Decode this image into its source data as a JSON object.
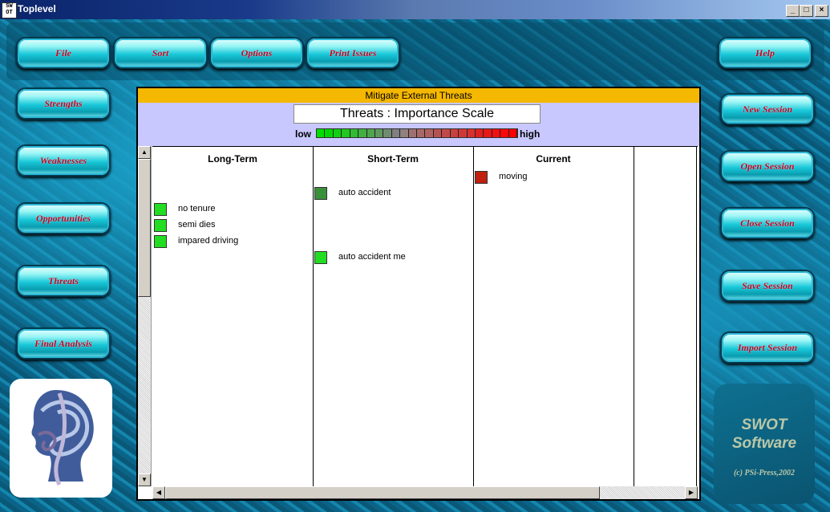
{
  "window": {
    "title": "Toplevel",
    "icon_text": "SW OT",
    "controls": [
      "_",
      "□",
      "×"
    ]
  },
  "toolbar": [
    {
      "label": "File"
    },
    {
      "label": "Sort"
    },
    {
      "label": "Options"
    },
    {
      "label": "Print Issues"
    },
    {
      "label": "Help"
    }
  ],
  "left_nav": [
    {
      "label": "Strengths"
    },
    {
      "label": "Weaknesses"
    },
    {
      "label": "Opportunities"
    },
    {
      "label": "Threats"
    },
    {
      "label": "Final Analysis"
    }
  ],
  "right_nav": [
    {
      "label": "New Session"
    },
    {
      "label": "Open Session"
    },
    {
      "label": "Close Session"
    },
    {
      "label": "Save Session"
    },
    {
      "label": "Import Session"
    }
  ],
  "panel": {
    "subtitle": "Mitigate External Threats",
    "scale_title": "Threats : Importance Scale",
    "scale_low": "low",
    "scale_high": "high",
    "scale_colors": [
      "#00e000",
      "#00d800",
      "#10d010",
      "#20c820",
      "#30bc30",
      "#40b040",
      "#50a450",
      "#609860",
      "#708c70",
      "#808080",
      "#908080",
      "#a07070",
      "#a86868",
      "#b06060",
      "#b85050",
      "#c04848",
      "#c84040",
      "#d03838",
      "#d83030",
      "#e02020",
      "#e81818",
      "#f01010",
      "#f80808",
      "#ff0000"
    ]
  },
  "columns": [
    {
      "header": "Long-Term",
      "items": [
        {
          "label": "no tenure",
          "color": "#22dd22"
        },
        {
          "label": "semi dies",
          "color": "#22dd22"
        },
        {
          "label": "impared driving",
          "color": "#22dd22"
        }
      ]
    },
    {
      "header": "Short-Term",
      "items": [
        {
          "label": "auto accident",
          "color": "#3a8f3a"
        },
        {
          "label": "auto accident me",
          "color": "#22dd22"
        }
      ]
    },
    {
      "header": "Current",
      "items": [
        {
          "label": "moving",
          "color": "#c02010"
        }
      ]
    }
  ],
  "brand": {
    "title": "SWOT\nSoftware",
    "copyright": "(c) PSi-Press,2002"
  }
}
